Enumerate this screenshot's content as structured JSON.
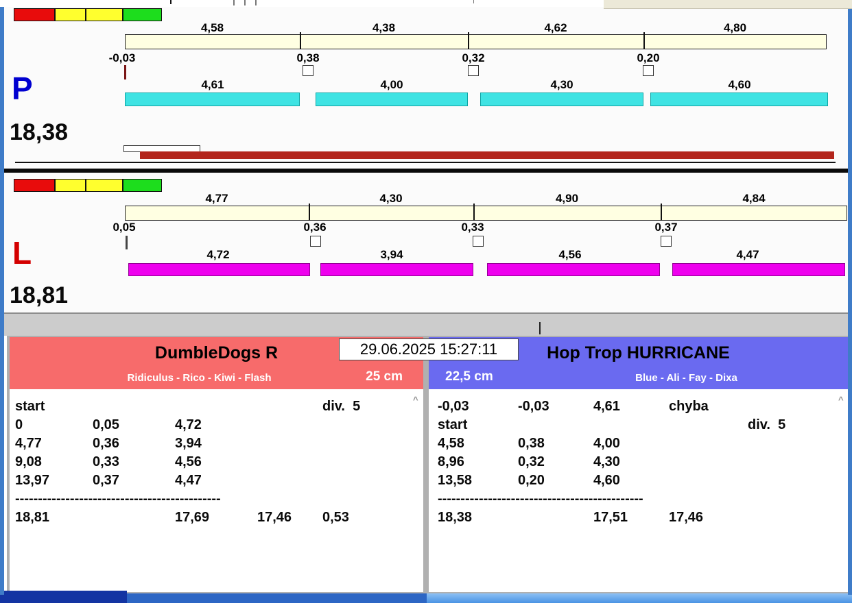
{
  "datetime": "29.06.2025 15:27:11",
  "colors": {
    "lane_p_bar": "#3fe3e3",
    "lane_l_bar": "#ee00ee",
    "split_bar": "#ffffe2",
    "progress_bar": "#b3251c",
    "left_header": "#f76b6b",
    "right_header": "#6a6af0",
    "lane_p_letter": "#0000d0",
    "lane_l_letter": "#d40000",
    "traffic_lights": [
      "#e80c0c",
      "#ffff2e",
      "#ffff2e",
      "#1ddd1d"
    ]
  },
  "lanes": {
    "p": {
      "label": "P",
      "total": "18,38",
      "top_splits": [
        "4,58",
        "4,38",
        "4,62",
        "4,80"
      ],
      "changes": [
        "-0,03",
        "0,38",
        "0,32",
        "0,20"
      ],
      "dog_splits": [
        "4,61",
        "4,00",
        "4,30",
        "4,60"
      ]
    },
    "l": {
      "label": "L",
      "total": "18,81",
      "top_splits": [
        "4,77",
        "4,30",
        "4,90",
        "4,84"
      ],
      "changes": [
        "0,05",
        "0,36",
        "0,33",
        "0,37"
      ],
      "dog_splits": [
        "4,72",
        "3,94",
        "4,56",
        "4,47"
      ]
    }
  },
  "left_panel": {
    "team": "DumbleDogs R",
    "members": "Ridiculus - Rico - Kiwi - Flash",
    "height": "25 cm",
    "rows": [
      [
        "start",
        "",
        "",
        "",
        "div.  5"
      ],
      [
        "0",
        "0,05",
        "4,72",
        "",
        ""
      ],
      [
        "4,77",
        "0,36",
        "3,94",
        "",
        ""
      ],
      [
        "9,08",
        "0,33",
        "4,56",
        "",
        ""
      ],
      [
        "13,97",
        "0,37",
        "4,47",
        "",
        ""
      ],
      [
        "---------------------------------------------",
        "",
        "",
        "",
        ""
      ],
      [
        "18,81",
        "",
        "17,69",
        "17,46",
        "0,53"
      ]
    ]
  },
  "right_panel": {
    "team": "Hop Trop HURRICANE",
    "members": "Blue - Ali - Fay - Dixa",
    "height": "22,5 cm",
    "rows": [
      [
        "-0,03",
        "-0,03",
        "4,61",
        "chyba",
        ""
      ],
      [
        "start",
        "",
        "",
        "",
        "div.  5"
      ],
      [
        "4,58",
        "0,38",
        "4,00",
        "",
        ""
      ],
      [
        "8,96",
        "0,32",
        "4,30",
        "",
        ""
      ],
      [
        "13,58",
        "0,20",
        "4,60",
        "",
        ""
      ],
      [
        "---------------------------------------------",
        "",
        "",
        "",
        ""
      ],
      [
        "18,38",
        "",
        "17,51",
        "17,46",
        ""
      ]
    ]
  }
}
